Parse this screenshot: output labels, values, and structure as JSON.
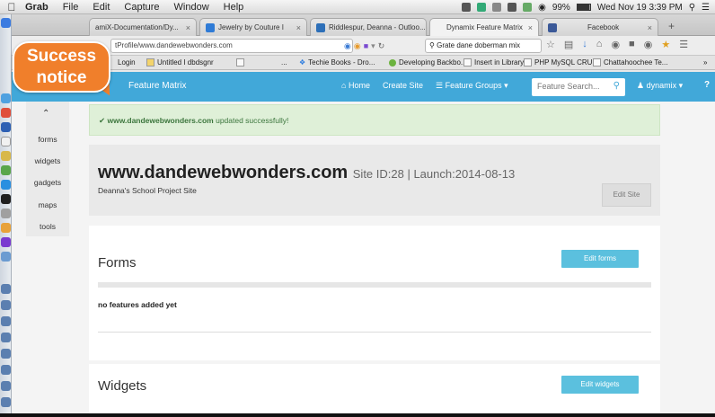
{
  "menubar": {
    "apple": "",
    "items": [
      "Grab",
      "File",
      "Edit",
      "Capture",
      "Window",
      "Help"
    ],
    "battery": "99%",
    "clock": "Wed Nov 19  3:39 PM"
  },
  "tabs": [
    {
      "label": "amiX-Documentation/Dy...",
      "color": "#6aa1d8"
    },
    {
      "label": "Jewelry by Couture I",
      "color": "#2f7bd6"
    },
    {
      "label": "Riddlespur, Deanna - Outloo...",
      "color": "#2d6fb8"
    },
    {
      "label": "Dynamix Feature Matrix",
      "color": "#ffffff"
    },
    {
      "label": "Facebook",
      "color": "#3b5998"
    }
  ],
  "navbar": {
    "url": "tProfile/www.dandewebwonders.com",
    "search": "Grate dane doberman mix"
  },
  "bookmarks": [
    "Login",
    "Untitled I dbdsgnr",
    "Techie Books - Dro...",
    "Developing Backbo...",
    "Insert in Library",
    "PHP MySQL CRU...",
    "Chattahoochee Te..."
  ],
  "app": {
    "brand": "Feature Matrix",
    "nav": [
      "Home",
      "Create Site",
      "Feature Groups"
    ],
    "search_placeholder": "Feature Search...",
    "user": "dynamix",
    "help": "?"
  },
  "sidebar": [
    "forms",
    "widgets",
    "gadgets",
    "maps",
    "tools"
  ],
  "alert": {
    "domain": "www.dandewebwonders.com",
    "rest": " updated successfully!"
  },
  "site": {
    "domain": "www.dandewebwonders.com",
    "meta": "Site ID:28 | Launch:2014-08-13",
    "description": "Deanna's School Project Site",
    "edit_label": "Edit Site"
  },
  "sections": [
    {
      "title": "Forms",
      "edit_label": "Edit forms",
      "empty": "no features added yet"
    },
    {
      "title": "Widgets",
      "edit_label": "Edit widgets"
    }
  ],
  "callout": {
    "line1": "Success",
    "line2": "notice"
  }
}
